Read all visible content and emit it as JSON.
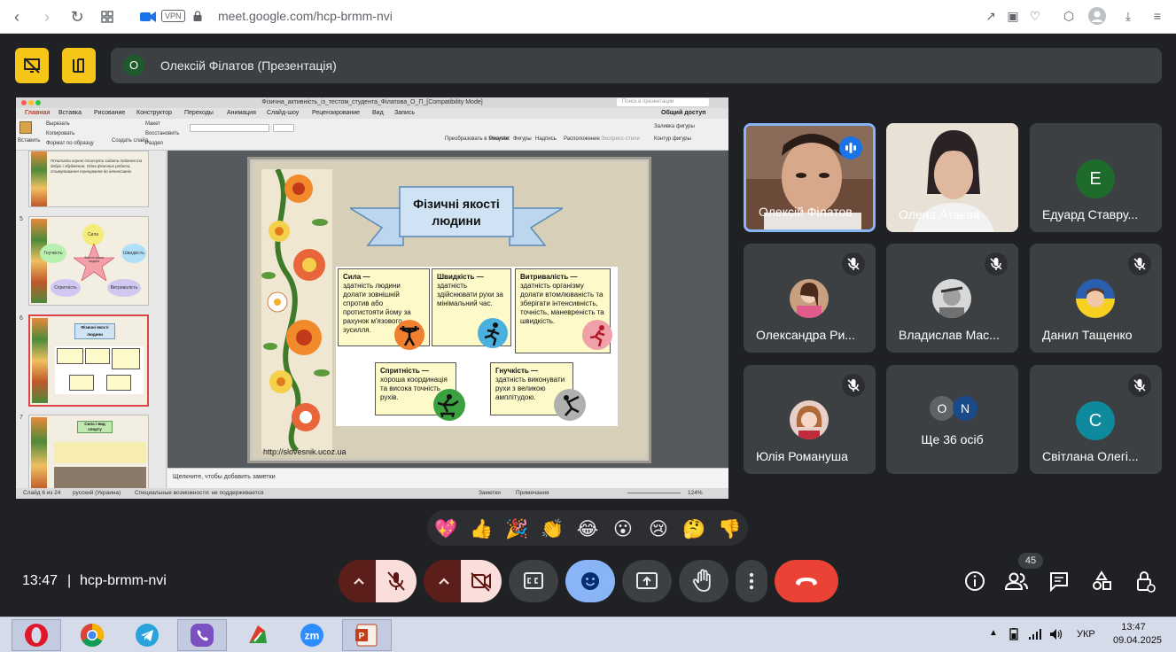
{
  "browser": {
    "url": "meet.google.com/hcp-brmm-nvi",
    "vpn_badge": "VPN"
  },
  "meet": {
    "presenter_initial": "О",
    "presenter_label": "Олексій Філатов (Презентація)",
    "time": "13:47",
    "separator": "|",
    "meeting_code": "hcp-brmm-nvi",
    "participant_count": "45"
  },
  "ppt": {
    "window_title": "Фізична_активність_із_тестом_студента_Філатова_О_П_[Compatibility Mode]",
    "search_placeholder": "Поиск в презентации",
    "share_label": "Общий доступ",
    "tabs": [
      "Главная",
      "Вставка",
      "Рисование",
      "Конструктор",
      "Переходы",
      "Анимация",
      "Слайд-шоу",
      "Рецензирование",
      "Вид",
      "Запись"
    ],
    "ribbon": {
      "paste": "Вставить",
      "cut": "Вырезать",
      "copy": "Копировать",
      "format": "Формат по образцу",
      "new_slide": "Создать слайд",
      "layout": "Макет",
      "reset": "Восстановить",
      "section": "Раздел",
      "smartart": "Преобразовать в SmartArt",
      "picture": "Рисунок",
      "shapes": "Фигуры",
      "textbox": "Надпись",
      "arrange": "Расположение",
      "quick_styles": "Экспресс-стили",
      "fill": "Заливка фигуры",
      "outline": "Контур фигуры"
    },
    "thumb_numbers": [
      "5",
      "6",
      "7"
    ],
    "thumb_top_text": "Почитати корені стиснути задати подання та добро і збуджения, Одна фізичних робота, стимулювання тренування до інтенсивніх",
    "thumb5_labels": [
      "Сила",
      "Гнучкість",
      "Швидкість",
      "Спритність",
      "Витривалість",
      "Фізичні якості людини"
    ],
    "thumb6_title": "Фізичні якості людини",
    "thumb7_title": "Сила і вид спорту",
    "notes_placeholder": "Щелкните, чтобы добавить заметки",
    "status": {
      "slide": "Слайд 6 из 24",
      "language": "русский (Украина)",
      "accessibility": "Специальные возможности: не поддерживается",
      "notes_btn": "Заметки",
      "comments_btn": "Примечания",
      "zoom": "124%"
    }
  },
  "slide": {
    "title_line1": "Фізичні якості",
    "title_line2": "людини",
    "cards": [
      {
        "head": "Сила —",
        "body": "здатність людини долати зовнішній спротив або протистояти йому за рахунок м'язового зусилля."
      },
      {
        "head": "Швидкість —",
        "body": "здатність здійснювати рухи за мінімальний час."
      },
      {
        "head": "Витривалість —",
        "body": "здатність організму долати втомлюваність та зберігати інтенсивність, точність, маневреність та швидкість."
      },
      {
        "head": "Спритність —",
        "body": "хороша координація та висока точність рухів."
      },
      {
        "head": "Гнучкість —",
        "body": "здатність виконувати рухи з великою амплітудою."
      }
    ],
    "source_url": "http://slovesnik.ucoz.ua"
  },
  "participants": [
    {
      "name": "Олексій Філатов",
      "type": "video-male",
      "speaking": true
    },
    {
      "name": "Олена Атаєва",
      "type": "video-female",
      "speaking": false
    },
    {
      "name": "Едуард Ставру...",
      "initial": "Е",
      "color": "#1e6b2c",
      "muted": false
    },
    {
      "name": "Олександра Ри...",
      "type": "photo",
      "muted": true
    },
    {
      "name": "Владислав Мас...",
      "type": "photo",
      "muted": true
    },
    {
      "name": "Данил Тащенко",
      "type": "photo",
      "muted": true
    },
    {
      "name": "Юлія Романуша",
      "type": "photo",
      "muted": true
    },
    {
      "name": "Ще 36 осіб",
      "mini": [
        "О",
        "N"
      ]
    },
    {
      "name": "Світлана Олегі...",
      "initial": "С",
      "color": "#0e8a9c",
      "muted": true
    }
  ],
  "reactions": [
    "💖",
    "👍",
    "🎉",
    "👏",
    "😂",
    "😮",
    "😢",
    "🤔",
    "👎"
  ],
  "taskbar": {
    "lang": "УКР",
    "time": "13:47",
    "date": "09.04.2025"
  },
  "colors": {
    "meet_bg": "#202124",
    "tile_bg": "#3c4043",
    "accent_yellow": "#f5c518",
    "hangup_red": "#ea4335",
    "active_blue": "#8ab4f8"
  }
}
